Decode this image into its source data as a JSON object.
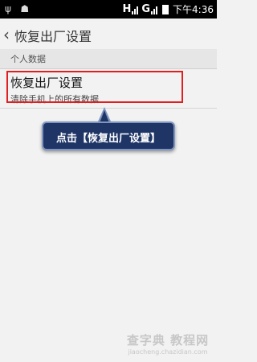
{
  "status_bar": {
    "icons_left": [
      "usb-icon",
      "android-icon"
    ],
    "network_1": "H",
    "network_2": "G",
    "time": "下午4:36"
  },
  "action_bar": {
    "back_glyph": "‹",
    "title": "恢复出厂设置"
  },
  "section": {
    "header": "个人数据"
  },
  "items": [
    {
      "title": "恢复出厂设置",
      "subtitle": "清除手机上的所有数据"
    }
  ],
  "annotation": {
    "callout_text": "点击【恢复出厂设置】",
    "highlight_color": "#e02020",
    "callout_color": "#1e3566"
  },
  "watermark": {
    "main": "查字典 教程网",
    "sub": "jiaocheng.chazidian.com"
  }
}
